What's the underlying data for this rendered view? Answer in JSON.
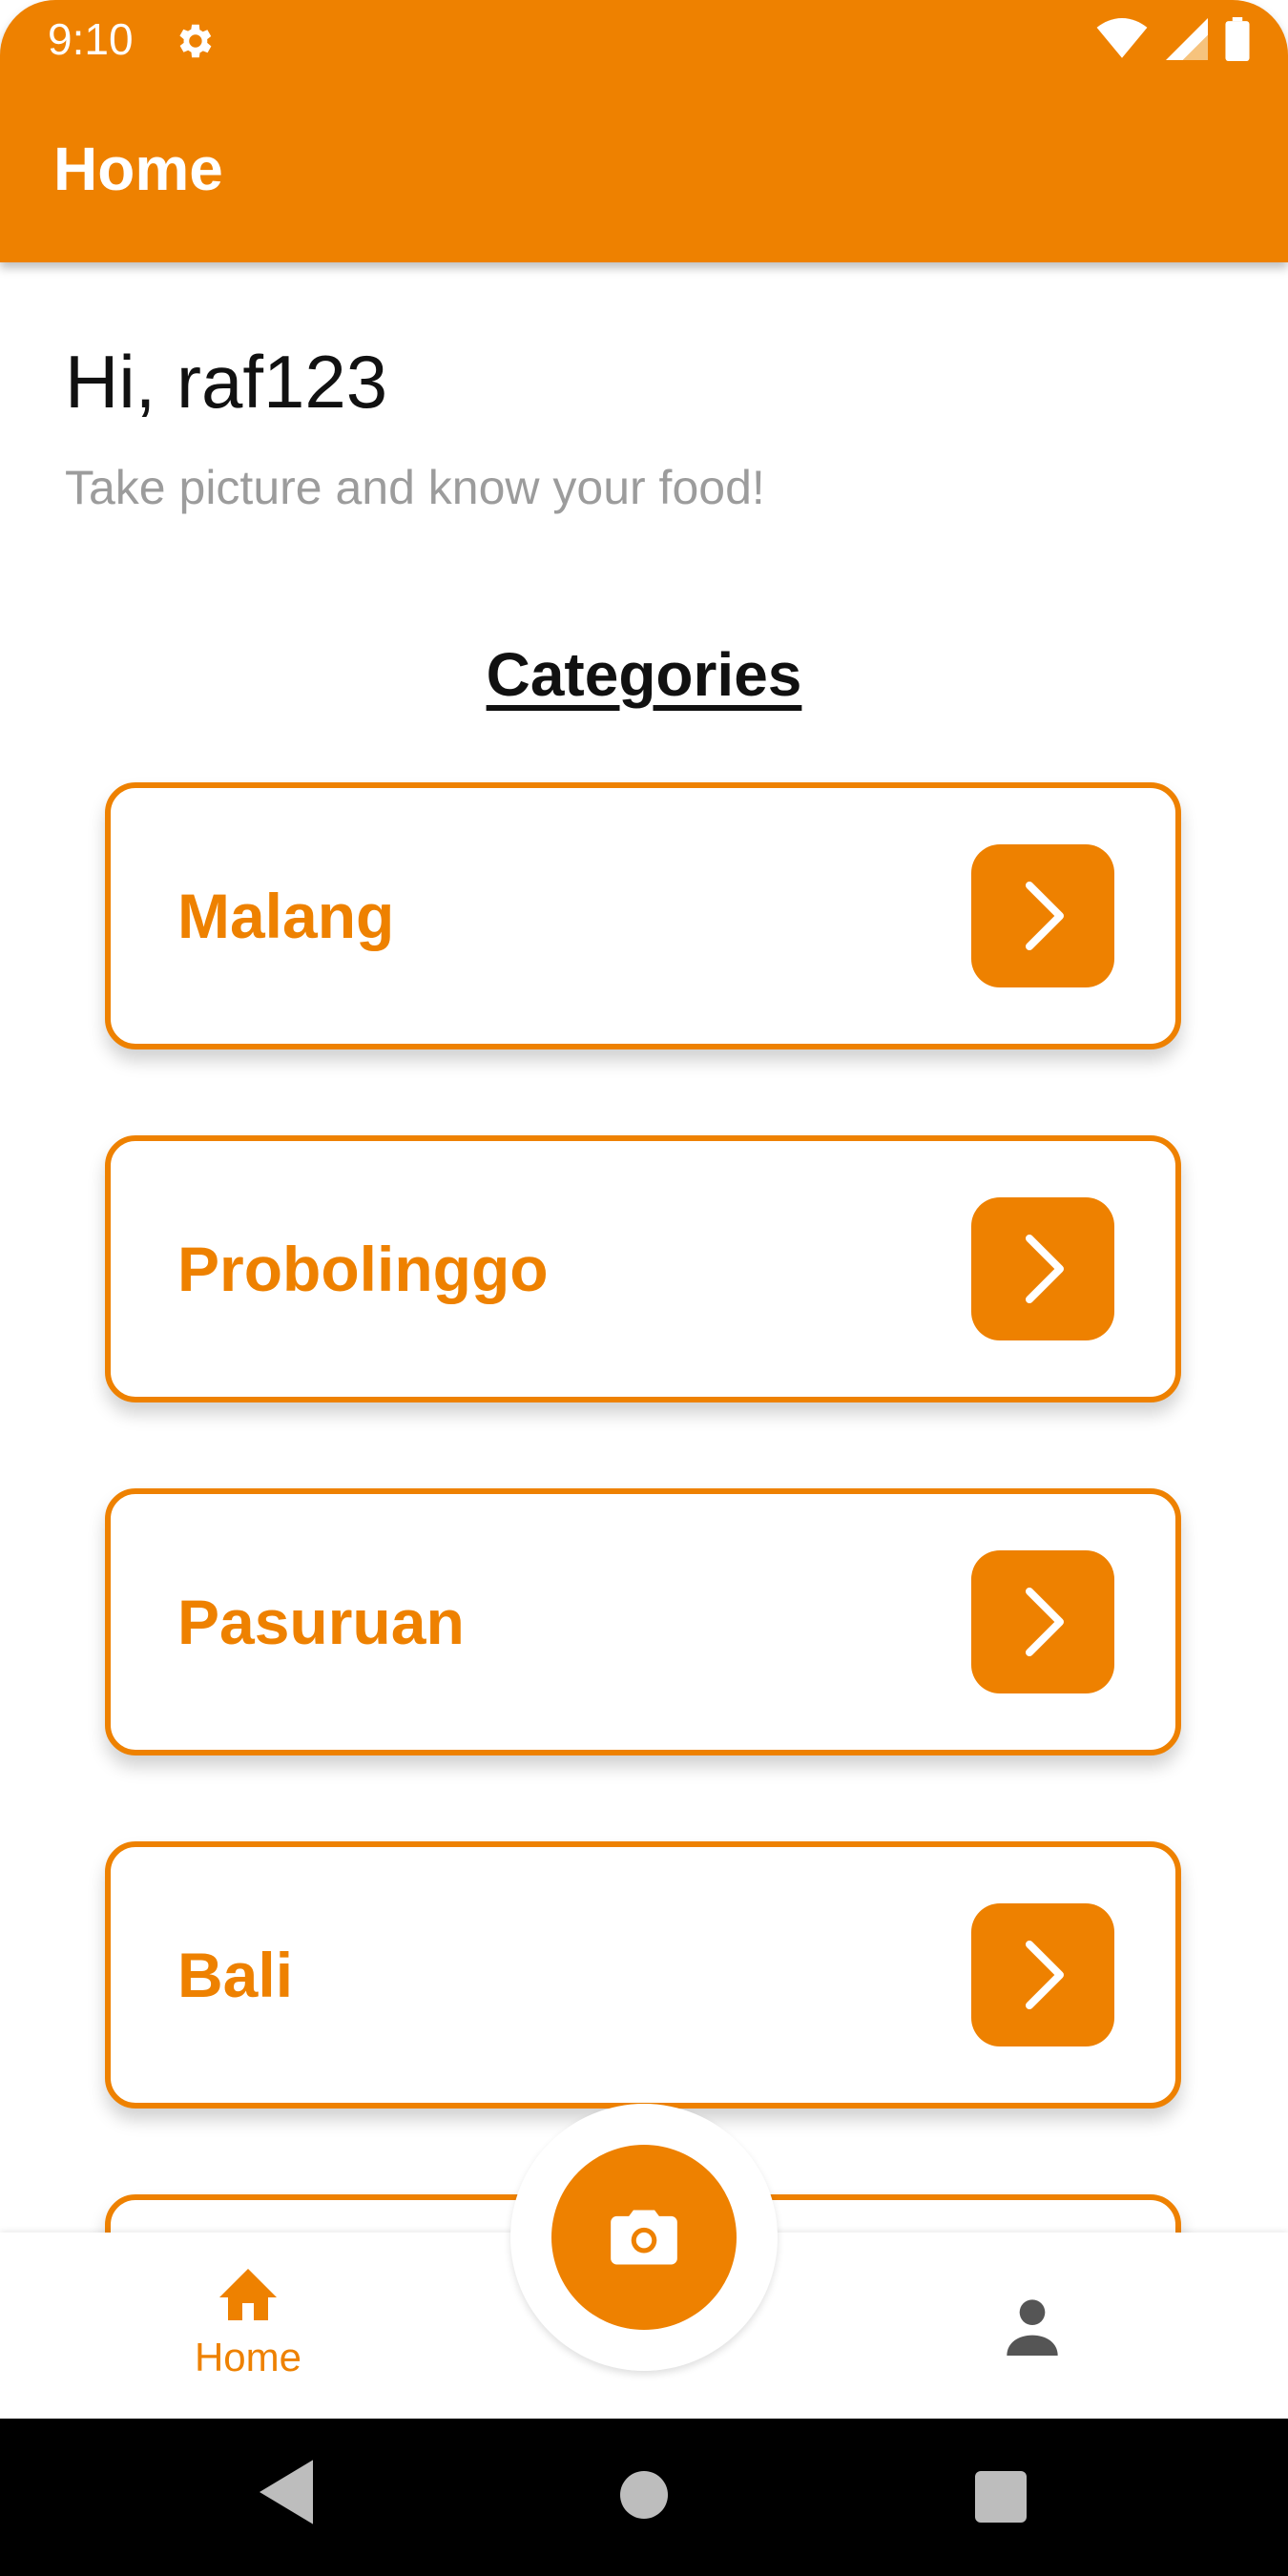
{
  "status_bar": {
    "time": "9:10"
  },
  "app_bar": {
    "title": "Home"
  },
  "greeting": {
    "text": "Hi, raf123",
    "subtitle": "Take picture and know your food!"
  },
  "categories": {
    "title": "Categories",
    "items": [
      {
        "label": "Malang"
      },
      {
        "label": "Probolinggo"
      },
      {
        "label": "Pasuruan"
      },
      {
        "label": "Bali"
      }
    ]
  },
  "bottom_nav": {
    "home_label": "Home",
    "fab_icon": "camera-icon",
    "profile_icon": "person-icon"
  },
  "colors": {
    "accent": "#EE8100",
    "text": "#111111",
    "muted": "#9C9C9C"
  }
}
